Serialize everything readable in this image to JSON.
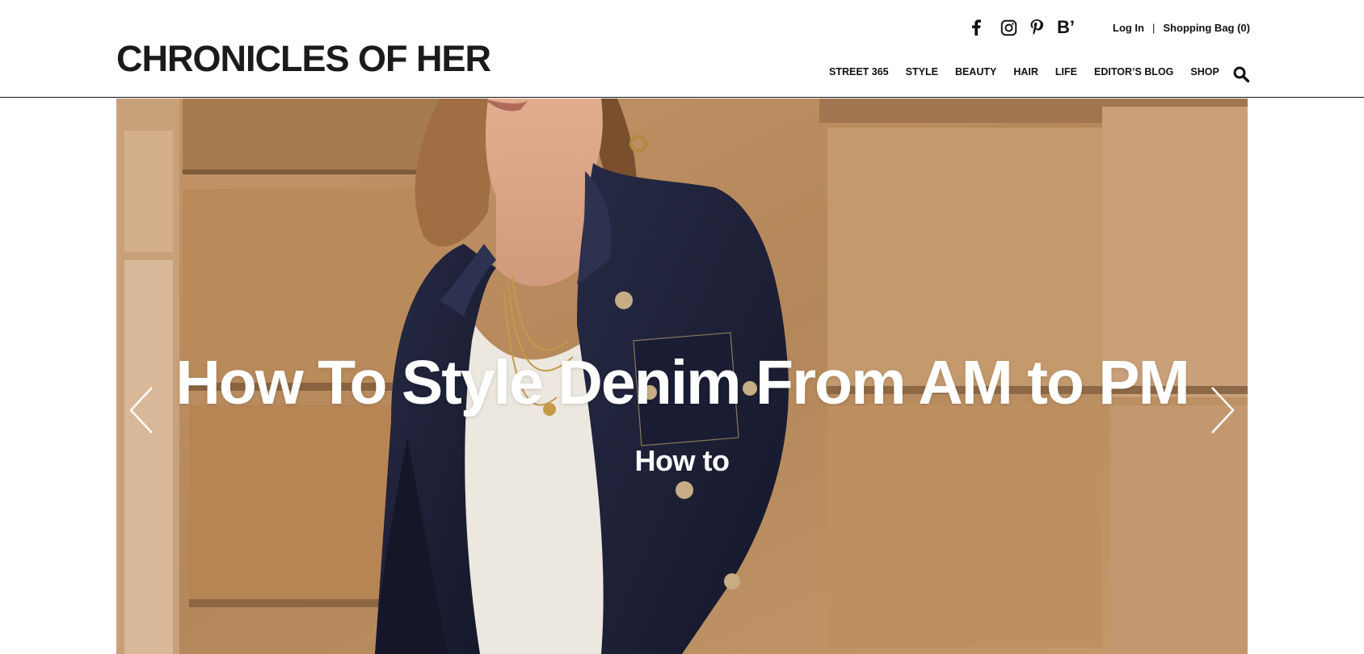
{
  "brand": {
    "logo_text": "CHRONICLES OF HER"
  },
  "social": [
    {
      "name": "facebook-icon",
      "glyph": "f"
    },
    {
      "name": "instagram-icon"
    },
    {
      "name": "pinterest-icon"
    },
    {
      "name": "bloglovin-icon",
      "glyph": "B’"
    }
  ],
  "utility": {
    "login": "Log In",
    "separator": "|",
    "bag": "Shopping Bag (0)"
  },
  "nav": {
    "items": [
      "STREET 365",
      "STYLE",
      "BEAUTY",
      "HAIR",
      "LIFE",
      "EDITOR’S BLOG",
      "SHOP"
    ]
  },
  "hero": {
    "title": "How To Style Denim From AM to PM",
    "category": "How to"
  },
  "colors": {
    "text": "#111111",
    "white": "#ffffff",
    "sandstone": "#b88b5d",
    "denim": "#1c1f33"
  }
}
